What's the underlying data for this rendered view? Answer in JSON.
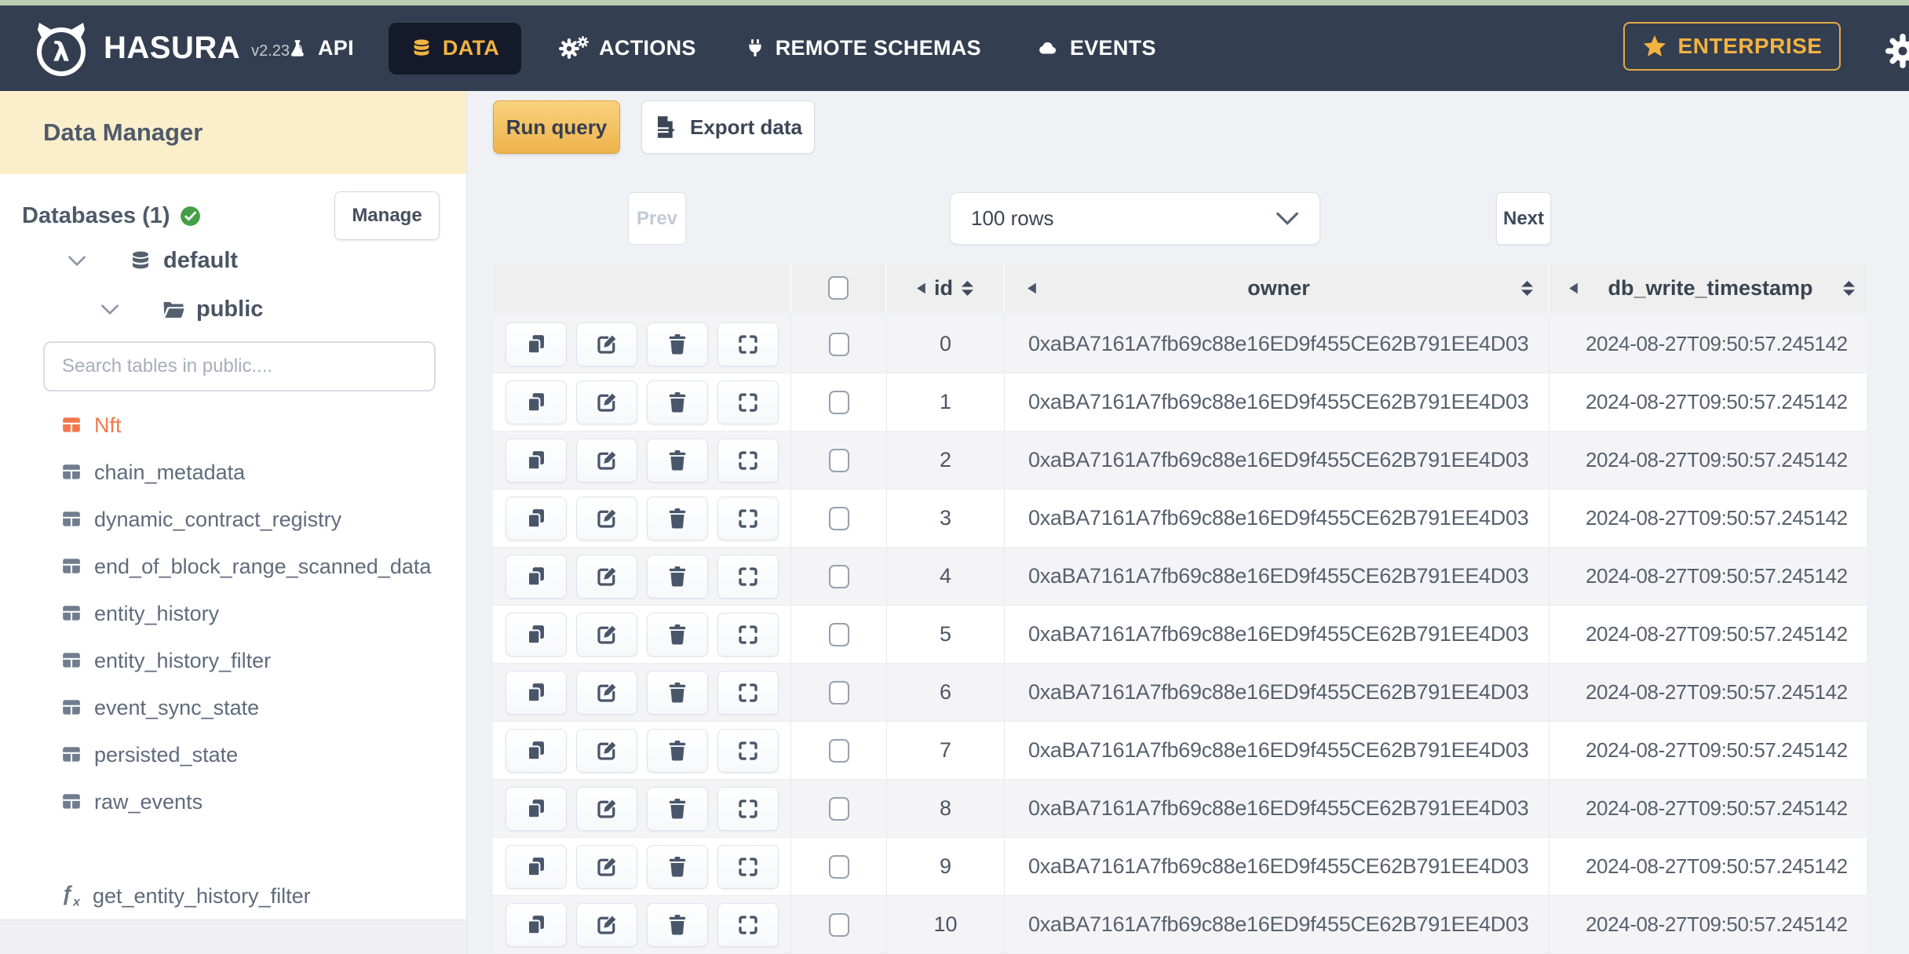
{
  "nav": {
    "brand": "HASURA",
    "version": "v2.23.0",
    "items": [
      {
        "label": "API"
      },
      {
        "label": "DATA",
        "active": true
      },
      {
        "label": "ACTIONS"
      },
      {
        "label": "REMOTE SCHEMAS"
      },
      {
        "label": "EVENTS"
      }
    ],
    "enterprise_label": "ENTERPRISE"
  },
  "sidebar": {
    "title": "Data Manager",
    "databases_label": "Databases (1)",
    "manage_label": "Manage",
    "tree": {
      "database": "default",
      "schema": "public"
    },
    "search_placeholder": "Search tables in public....",
    "tables": [
      {
        "label": "Nft",
        "active": true
      },
      {
        "label": "chain_metadata"
      },
      {
        "label": "dynamic_contract_registry"
      },
      {
        "label": "end_of_block_range_scanned_data"
      },
      {
        "label": "entity_history"
      },
      {
        "label": "entity_history_filter"
      },
      {
        "label": "event_sync_state"
      },
      {
        "label": "persisted_state"
      },
      {
        "label": "raw_events"
      }
    ],
    "function_label": "get_entity_history_filter"
  },
  "toolbar": {
    "run_query_label": "Run query",
    "export_data_label": "Export data"
  },
  "pagination": {
    "prev_label": "Prev",
    "rows_value": "100 rows",
    "next_label": "Next"
  },
  "grid": {
    "columns": {
      "id": "id",
      "owner": "owner",
      "timestamp": "db_write_timestamp"
    },
    "rows": [
      {
        "id": "0",
        "owner": "0xaBA7161A7fb69c88e16ED9f455CE62B791EE4D03",
        "db_write_timestamp": "2024-08-27T09:50:57.245142"
      },
      {
        "id": "1",
        "owner": "0xaBA7161A7fb69c88e16ED9f455CE62B791EE4D03",
        "db_write_timestamp": "2024-08-27T09:50:57.245142"
      },
      {
        "id": "2",
        "owner": "0xaBA7161A7fb69c88e16ED9f455CE62B791EE4D03",
        "db_write_timestamp": "2024-08-27T09:50:57.245142"
      },
      {
        "id": "3",
        "owner": "0xaBA7161A7fb69c88e16ED9f455CE62B791EE4D03",
        "db_write_timestamp": "2024-08-27T09:50:57.245142"
      },
      {
        "id": "4",
        "owner": "0xaBA7161A7fb69c88e16ED9f455CE62B791EE4D03",
        "db_write_timestamp": "2024-08-27T09:50:57.245142"
      },
      {
        "id": "5",
        "owner": "0xaBA7161A7fb69c88e16ED9f455CE62B791EE4D03",
        "db_write_timestamp": "2024-08-27T09:50:57.245142"
      },
      {
        "id": "6",
        "owner": "0xaBA7161A7fb69c88e16ED9f455CE62B791EE4D03",
        "db_write_timestamp": "2024-08-27T09:50:57.245142"
      },
      {
        "id": "7",
        "owner": "0xaBA7161A7fb69c88e16ED9f455CE62B791EE4D03",
        "db_write_timestamp": "2024-08-27T09:50:57.245142"
      },
      {
        "id": "8",
        "owner": "0xaBA7161A7fb69c88e16ED9f455CE62B791EE4D03",
        "db_write_timestamp": "2024-08-27T09:50:57.245142"
      },
      {
        "id": "9",
        "owner": "0xaBA7161A7fb69c88e16ED9f455CE62B791EE4D03",
        "db_write_timestamp": "2024-08-27T09:50:57.245142"
      },
      {
        "id": "10",
        "owner": "0xaBA7161A7fb69c88e16ED9f455CE62B791EE4D03",
        "db_write_timestamp": "2024-08-27T09:50:57.245142"
      }
    ]
  },
  "colors": {
    "accent_amber": "#f2b341",
    "brand_navy": "#343e51",
    "selected_table_orange": "#f2784b",
    "status_green": "#43a047",
    "topstrip_green": "#b9cdb4"
  }
}
